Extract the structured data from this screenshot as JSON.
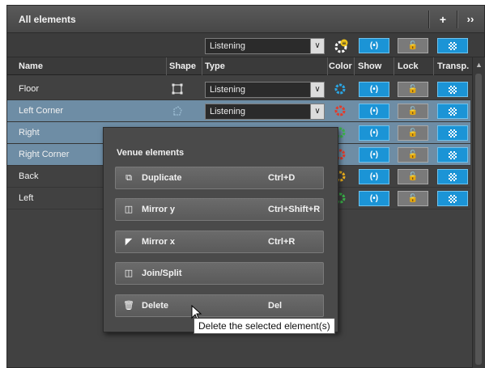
{
  "header": {
    "title": "All elements",
    "add_label": "+",
    "expand_label": "››"
  },
  "toolbar": {
    "type_select": "Listening"
  },
  "columns": {
    "name": "Name",
    "shape": "Shape",
    "type": "Type",
    "color": "Color",
    "show": "Show",
    "lock": "Lock",
    "transp": "Transp."
  },
  "rows": [
    {
      "name": "Floor",
      "type": "Listening",
      "selected": false,
      "color": "#2aa7e6"
    },
    {
      "name": "Left Corner",
      "type": "Listening",
      "selected": true,
      "color": "#e23b2a"
    },
    {
      "name": "Right",
      "type": "",
      "selected": true,
      "color": "#3bb34a"
    },
    {
      "name": "Right Corner",
      "type": "",
      "selected": true,
      "color": "#e23b2a"
    },
    {
      "name": "Back",
      "type": "",
      "selected": false,
      "color": "#f0b21d"
    },
    {
      "name": "Left",
      "type": "",
      "selected": false,
      "color": "#3bb34a"
    }
  ],
  "context_menu": {
    "title": "Venue elements",
    "items": [
      {
        "label": "Duplicate",
        "shortcut": "Ctrl+D",
        "icon": "duplicate-icon"
      },
      {
        "label": "Mirror y",
        "shortcut": "Ctrl+Shift+R",
        "icon": "mirror-y-icon"
      },
      {
        "label": "Mirror x",
        "shortcut": "Ctrl+R",
        "icon": "mirror-x-icon"
      },
      {
        "label": "Join/Split",
        "shortcut": "",
        "icon": "join-split-icon"
      },
      {
        "label": "Delete",
        "shortcut": "Del",
        "icon": "trash-icon"
      }
    ]
  },
  "tooltip": "Delete the selected element(s)",
  "colors": {
    "accent_blue": "#1b94d6",
    "selected_row": "#6e8da5",
    "panel_bg": "#414141"
  }
}
